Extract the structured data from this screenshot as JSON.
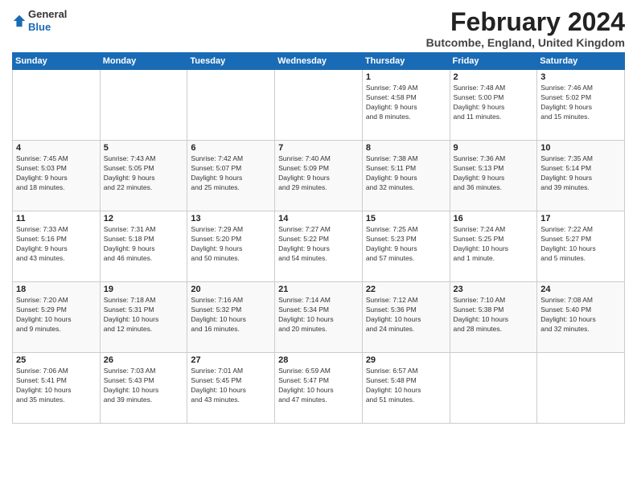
{
  "app": {
    "logo_line1": "General",
    "logo_line2": "Blue"
  },
  "header": {
    "title": "February 2024",
    "location": "Butcombe, England, United Kingdom"
  },
  "weekdays": [
    "Sunday",
    "Monday",
    "Tuesday",
    "Wednesday",
    "Thursday",
    "Friday",
    "Saturday"
  ],
  "weeks": [
    [
      {
        "day": "",
        "info": ""
      },
      {
        "day": "",
        "info": ""
      },
      {
        "day": "",
        "info": ""
      },
      {
        "day": "",
        "info": ""
      },
      {
        "day": "1",
        "info": "Sunrise: 7:49 AM\nSunset: 4:58 PM\nDaylight: 9 hours\nand 8 minutes."
      },
      {
        "day": "2",
        "info": "Sunrise: 7:48 AM\nSunset: 5:00 PM\nDaylight: 9 hours\nand 11 minutes."
      },
      {
        "day": "3",
        "info": "Sunrise: 7:46 AM\nSunset: 5:02 PM\nDaylight: 9 hours\nand 15 minutes."
      }
    ],
    [
      {
        "day": "4",
        "info": "Sunrise: 7:45 AM\nSunset: 5:03 PM\nDaylight: 9 hours\nand 18 minutes."
      },
      {
        "day": "5",
        "info": "Sunrise: 7:43 AM\nSunset: 5:05 PM\nDaylight: 9 hours\nand 22 minutes."
      },
      {
        "day": "6",
        "info": "Sunrise: 7:42 AM\nSunset: 5:07 PM\nDaylight: 9 hours\nand 25 minutes."
      },
      {
        "day": "7",
        "info": "Sunrise: 7:40 AM\nSunset: 5:09 PM\nDaylight: 9 hours\nand 29 minutes."
      },
      {
        "day": "8",
        "info": "Sunrise: 7:38 AM\nSunset: 5:11 PM\nDaylight: 9 hours\nand 32 minutes."
      },
      {
        "day": "9",
        "info": "Sunrise: 7:36 AM\nSunset: 5:13 PM\nDaylight: 9 hours\nand 36 minutes."
      },
      {
        "day": "10",
        "info": "Sunrise: 7:35 AM\nSunset: 5:14 PM\nDaylight: 9 hours\nand 39 minutes."
      }
    ],
    [
      {
        "day": "11",
        "info": "Sunrise: 7:33 AM\nSunset: 5:16 PM\nDaylight: 9 hours\nand 43 minutes."
      },
      {
        "day": "12",
        "info": "Sunrise: 7:31 AM\nSunset: 5:18 PM\nDaylight: 9 hours\nand 46 minutes."
      },
      {
        "day": "13",
        "info": "Sunrise: 7:29 AM\nSunset: 5:20 PM\nDaylight: 9 hours\nand 50 minutes."
      },
      {
        "day": "14",
        "info": "Sunrise: 7:27 AM\nSunset: 5:22 PM\nDaylight: 9 hours\nand 54 minutes."
      },
      {
        "day": "15",
        "info": "Sunrise: 7:25 AM\nSunset: 5:23 PM\nDaylight: 9 hours\nand 57 minutes."
      },
      {
        "day": "16",
        "info": "Sunrise: 7:24 AM\nSunset: 5:25 PM\nDaylight: 10 hours\nand 1 minute."
      },
      {
        "day": "17",
        "info": "Sunrise: 7:22 AM\nSunset: 5:27 PM\nDaylight: 10 hours\nand 5 minutes."
      }
    ],
    [
      {
        "day": "18",
        "info": "Sunrise: 7:20 AM\nSunset: 5:29 PM\nDaylight: 10 hours\nand 9 minutes."
      },
      {
        "day": "19",
        "info": "Sunrise: 7:18 AM\nSunset: 5:31 PM\nDaylight: 10 hours\nand 12 minutes."
      },
      {
        "day": "20",
        "info": "Sunrise: 7:16 AM\nSunset: 5:32 PM\nDaylight: 10 hours\nand 16 minutes."
      },
      {
        "day": "21",
        "info": "Sunrise: 7:14 AM\nSunset: 5:34 PM\nDaylight: 10 hours\nand 20 minutes."
      },
      {
        "day": "22",
        "info": "Sunrise: 7:12 AM\nSunset: 5:36 PM\nDaylight: 10 hours\nand 24 minutes."
      },
      {
        "day": "23",
        "info": "Sunrise: 7:10 AM\nSunset: 5:38 PM\nDaylight: 10 hours\nand 28 minutes."
      },
      {
        "day": "24",
        "info": "Sunrise: 7:08 AM\nSunset: 5:40 PM\nDaylight: 10 hours\nand 32 minutes."
      }
    ],
    [
      {
        "day": "25",
        "info": "Sunrise: 7:06 AM\nSunset: 5:41 PM\nDaylight: 10 hours\nand 35 minutes."
      },
      {
        "day": "26",
        "info": "Sunrise: 7:03 AM\nSunset: 5:43 PM\nDaylight: 10 hours\nand 39 minutes."
      },
      {
        "day": "27",
        "info": "Sunrise: 7:01 AM\nSunset: 5:45 PM\nDaylight: 10 hours\nand 43 minutes."
      },
      {
        "day": "28",
        "info": "Sunrise: 6:59 AM\nSunset: 5:47 PM\nDaylight: 10 hours\nand 47 minutes."
      },
      {
        "day": "29",
        "info": "Sunrise: 6:57 AM\nSunset: 5:48 PM\nDaylight: 10 hours\nand 51 minutes."
      },
      {
        "day": "",
        "info": ""
      },
      {
        "day": "",
        "info": ""
      }
    ]
  ]
}
